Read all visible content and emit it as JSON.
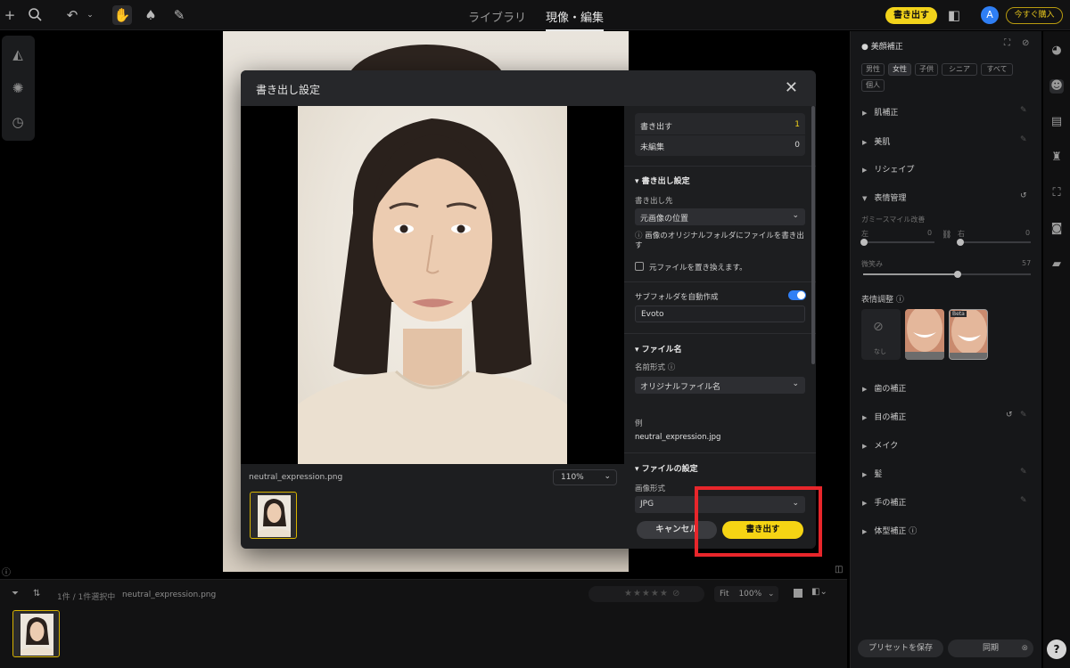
{
  "topbar": {
    "tabs": [
      "ライブラリ",
      "現像・編集"
    ],
    "export_label": "書き出す",
    "avatar_letter": "A",
    "buy_label": "今すぐ購入"
  },
  "dialog": {
    "title": "書き出し設定",
    "close_glyph": "✕",
    "preview_filename": "neutral_expression.png",
    "zoom_value": "110%",
    "summary": [
      {
        "label": "書き出す",
        "value": "1"
      },
      {
        "label": "未編集",
        "value": "0"
      }
    ],
    "export_section_title": "書き出し設定",
    "destination_label": "書き出し先",
    "destination_value": "元画像の位置",
    "destination_info": "画像のオリジナルフォルダにファイルを書き出す",
    "overwrite_label": "元ファイルを置き換えます。",
    "subfolder_label": "サブフォルダを自動作成",
    "subfolder_value": "Evoto",
    "filename_section_title": "ファイル名",
    "name_format_label": "名前形式 ⓘ",
    "name_format_value": "オリジナルファイル名",
    "example_label": "例",
    "example_value": "neutral_expression.jpg",
    "file_settings_title": "ファイルの設定",
    "image_format_label": "画像形式",
    "image_format_value": "JPG",
    "cancel_label": "キャンセル",
    "export_label": "書き出す"
  },
  "filmstrip": {
    "selection_text": "1件 / 1件選択中",
    "filename": "neutral_expression.png",
    "fit_label": "Fit",
    "zoom_value": "100%"
  },
  "right_panel": {
    "title": "美顔補正",
    "tags": [
      "男性",
      "女性",
      "子供",
      "シニア",
      "すべて",
      "個人"
    ],
    "items_top": [
      "肌補正",
      "美肌",
      "リシェイプ",
      "表情管理"
    ],
    "smile_label": "ガミースマイル改善",
    "left_label": "左",
    "left_value": "0",
    "right_label": "右",
    "right_value": "0",
    "laugh_label": "微笑み",
    "laugh_value": "57",
    "expression_label": "表情調整 ⓘ",
    "none_label": "なし",
    "beta_label": "Beta",
    "items_bottom": [
      "歯の補正",
      "目の補正",
      "メイク",
      "髪",
      "手の補正",
      "体型補正 ⓘ"
    ],
    "save_preset": "プリセットを保存",
    "sync_label": "同期"
  },
  "colors": {
    "accent_yellow": "#f5d414",
    "highlight_red": "#e8262b",
    "toggle_blue": "#2f7ff5"
  }
}
